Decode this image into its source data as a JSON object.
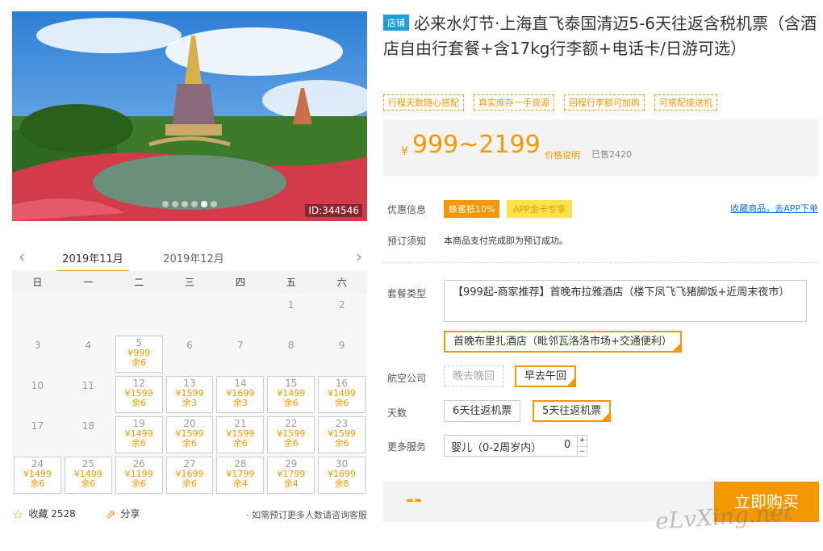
{
  "gallery": {
    "photo_id": "ID:344546",
    "dots": 6,
    "active_dot": 4
  },
  "calendar": {
    "prev_icon": "chevron-left-icon",
    "next_icon": "chevron-right-icon",
    "months": [
      "2019年11月",
      "2019年12月"
    ],
    "weekdays": [
      "日",
      "一",
      "二",
      "三",
      "四",
      "五",
      "六"
    ],
    "days": [
      {
        "d": ""
      },
      {
        "d": ""
      },
      {
        "d": ""
      },
      {
        "d": ""
      },
      {
        "d": ""
      },
      {
        "d": "1"
      },
      {
        "d": "2"
      },
      {
        "d": "3"
      },
      {
        "d": "4"
      },
      {
        "d": "5",
        "price": "¥999",
        "stock": "余6"
      },
      {
        "d": "6"
      },
      {
        "d": "7"
      },
      {
        "d": "8"
      },
      {
        "d": "9"
      },
      {
        "d": "10"
      },
      {
        "d": "11"
      },
      {
        "d": "12",
        "price": "¥1599",
        "stock": "余6"
      },
      {
        "d": "13",
        "price": "¥1599",
        "stock": "余3"
      },
      {
        "d": "14",
        "price": "¥1699",
        "stock": "余3"
      },
      {
        "d": "15",
        "price": "¥1499",
        "stock": "余6"
      },
      {
        "d": "16",
        "price": "¥1499",
        "stock": "余6"
      },
      {
        "d": "17"
      },
      {
        "d": "18"
      },
      {
        "d": "19",
        "price": "¥1499",
        "stock": "余6"
      },
      {
        "d": "20",
        "price": "¥1599",
        "stock": "余6"
      },
      {
        "d": "21",
        "price": "¥1599",
        "stock": "余6"
      },
      {
        "d": "22",
        "price": "¥1599",
        "stock": "余6"
      },
      {
        "d": "23",
        "price": "¥1599",
        "stock": "余6"
      },
      {
        "d": "24",
        "price": "¥1499",
        "stock": "余6"
      },
      {
        "d": "25",
        "price": "¥1499",
        "stock": "余6"
      },
      {
        "d": "26",
        "price": "¥1199",
        "stock": "余6"
      },
      {
        "d": "27",
        "price": "¥1699",
        "stock": "余6"
      },
      {
        "d": "28",
        "price": "¥1799",
        "stock": "余4"
      },
      {
        "d": "29",
        "price": "¥1799",
        "stock": "余4"
      },
      {
        "d": "30",
        "price": "¥1699",
        "stock": "余8"
      }
    ]
  },
  "footer": {
    "fav_label": "收藏",
    "fav_count": "2528",
    "share_label": "分享",
    "note": "· 如需预订更多人数请咨询客服"
  },
  "product": {
    "shop_badge": "店铺",
    "title": "必来水灯节·上海直飞泰国清迈5-6天往返含税机票（含酒店自由行套餐+含17kg行李额+电话卡/日游可选）",
    "tags": [
      "行程天数随心搭配",
      "真实库存一手资源",
      "回程行李额可加购",
      "可搭配接送机"
    ],
    "currency": "¥",
    "price": "999~2199",
    "price_explain": "价格说明",
    "sold": "已售2420",
    "promo_label": "优惠信息",
    "promo1": "蜂蜜抵10%",
    "promo2": "APP金卡专享",
    "app_link": "收藏商品，去APP下单",
    "notice_label": "预订须知",
    "notice": "本商品支付完成即为预订成功。",
    "package_label": "套餐类型",
    "package_options": [
      "【999起-商家推荐】首晚布拉雅酒店（楼下凤飞飞猪脚饭+近周末夜市）",
      "首晚布里扎酒店（毗邻瓦洛洛市场+交通便利）"
    ],
    "airline_label": "航空公司",
    "airline_options": [
      "晚去晚回",
      "早去午回"
    ],
    "days_label": "天数",
    "days_options": [
      "6天往返机票",
      "5天往返机票"
    ],
    "service_label": "更多服务",
    "service_item": "婴儿（0-2周岁内）",
    "service_qty": "0",
    "plus": "+",
    "minus": "−",
    "buy_dash": "--",
    "buy_label": "立即购买"
  },
  "watermark": "eLvXing.net"
}
